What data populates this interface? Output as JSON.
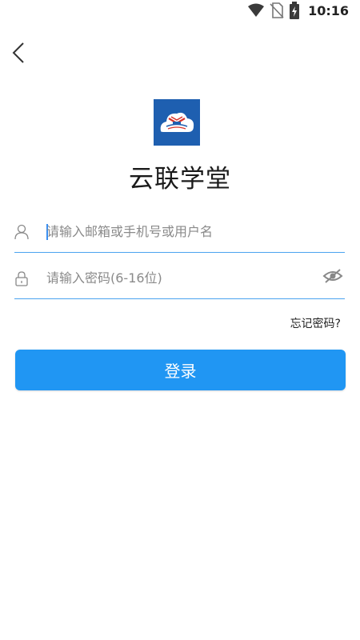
{
  "status_bar": {
    "time": "10:16"
  },
  "app": {
    "title": "云联学堂"
  },
  "form": {
    "username_placeholder": "请输入邮箱或手机号或用户名",
    "password_placeholder": "请输入密码(6-16位)",
    "forgot_label": "忘记密码?",
    "login_label": "登录"
  },
  "icons": {
    "back": "back-arrow-icon",
    "user": "user-icon",
    "lock": "lock-icon",
    "eye": "eye-off-icon",
    "wifi": "wifi-icon",
    "no_sim": "no-sim-icon",
    "battery": "battery-charging-icon"
  },
  "colors": {
    "primary": "#2096f3",
    "underline": "#4aa3f0",
    "logo_bg": "#1e5fb0"
  }
}
